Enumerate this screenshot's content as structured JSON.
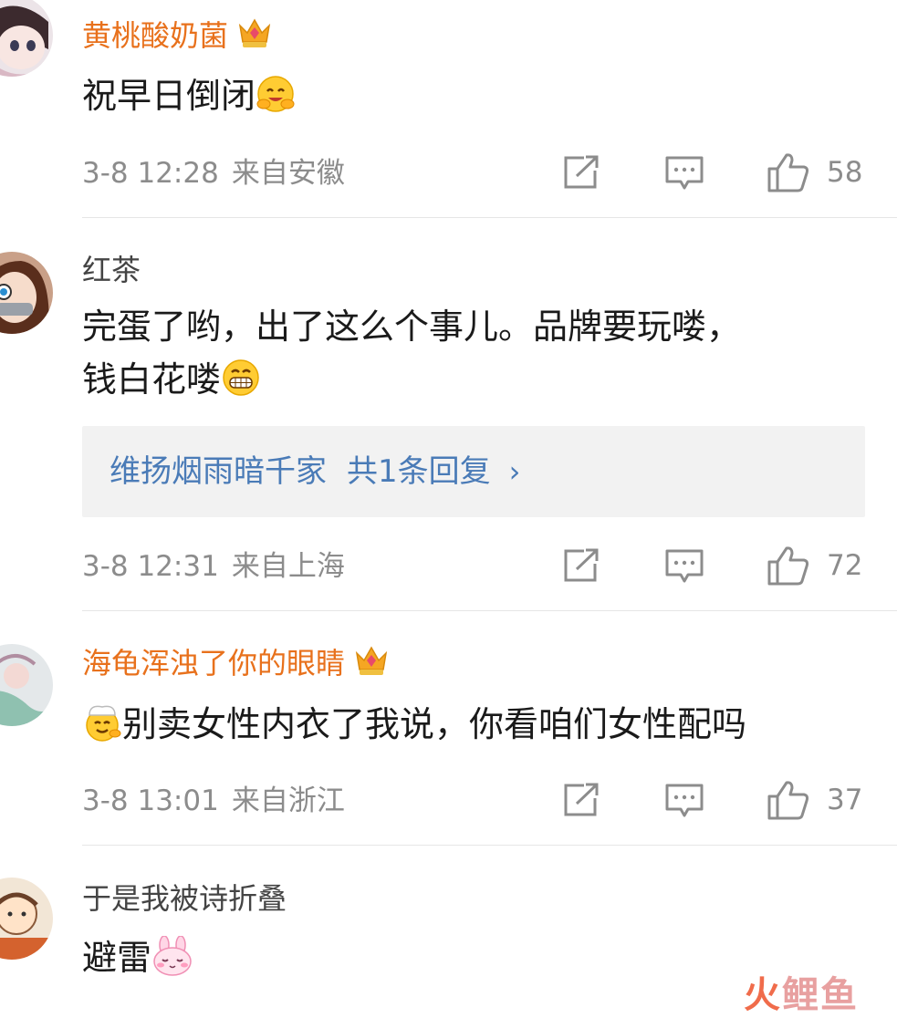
{
  "comments": [
    {
      "username": "黄桃酸奶菌",
      "vip": true,
      "text_lines": [
        "祝早日倒闭"
      ],
      "emoji": "hug-emoji",
      "time": "3-8 12:28",
      "source": "来自安徽",
      "likes": "58"
    },
    {
      "username": "红茶",
      "vip": false,
      "text_lines": [
        "完蛋了哟，出了这么个事儿。品牌要玩喽，",
        "钱白花喽"
      ],
      "emoji": "grin-emoji",
      "reply": {
        "user": "维扬烟雨暗千家",
        "count_text": "共1条回复",
        "chevron": "›"
      },
      "time": "3-8 12:31",
      "source": "来自上海",
      "likes": "72"
    },
    {
      "username": "海龟浑浊了你的眼睛",
      "vip": true,
      "text_lines": [
        "别卖女性内衣了我说，你看咱们女性配吗"
      ],
      "emoji": "chef-emoji",
      "time": "3-8 13:01",
      "source": "来自浙江",
      "likes": "37"
    },
    {
      "username": "于是我被诗折叠",
      "vip": false,
      "text_lines": [
        "避雷"
      ],
      "emoji": "bunny-emoji"
    }
  ],
  "watermark": {
    "part1": "火",
    "part2": "鲤鱼"
  },
  "colors": {
    "vip_name": "#e8711c",
    "link": "#4a7bb7",
    "meta": "#8c8c8c"
  }
}
